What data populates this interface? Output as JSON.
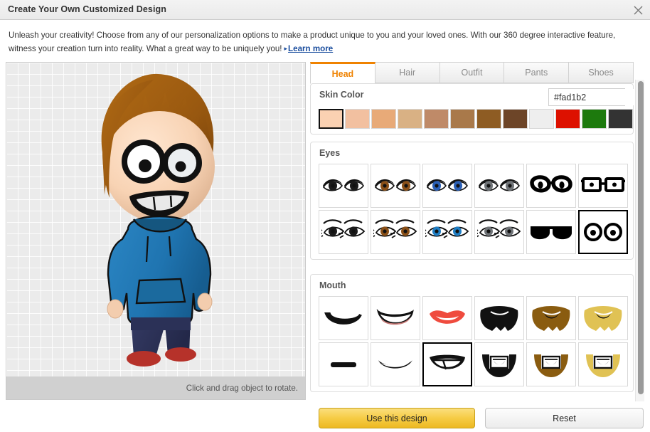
{
  "window": {
    "title": "Create Your Own Customized Design",
    "close_icon": "close-icon"
  },
  "intro": {
    "text": "Unleash your creativity! Choose from any of our personalization options to make a product unique to you and your loved ones. With our 360 degree interactive feature, witness your creation turn into reality. What a great way to be uniquely you!",
    "link_label": "Learn more",
    "link_arrow": "▸"
  },
  "preview": {
    "status_text": "Click and drag object to rotate.",
    "avatar": {
      "hair_color": "#a35f12",
      "skin_color": "#fad1b2",
      "shirt_color": "#1f74b0",
      "pants_color": "#2a2f55",
      "shoes_color": "#b6322a"
    }
  },
  "tabs": [
    {
      "label": "Head",
      "active": true
    },
    {
      "label": "Hair",
      "active": false
    },
    {
      "label": "Outfit",
      "active": false
    },
    {
      "label": "Pants",
      "active": false
    },
    {
      "label": "Shoes",
      "active": false
    }
  ],
  "skin_color": {
    "title": "Skin Color",
    "hex_value": "#fad1b2",
    "hex_placeholder": "#rrggbb",
    "preview_color": "#fad1b2",
    "swatches": [
      {
        "color": "#fad1b2",
        "selected": true
      },
      {
        "color": "#f2c0a0",
        "selected": false
      },
      {
        "color": "#e8aa78",
        "selected": false
      },
      {
        "color": "#d9b184",
        "selected": false
      },
      {
        "color": "#bf8a68",
        "selected": false
      },
      {
        "color": "#a9794a",
        "selected": false
      },
      {
        "color": "#8e5c23",
        "selected": false
      },
      {
        "color": "#6d4528",
        "selected": false
      },
      {
        "color": "#eeeeee",
        "selected": false
      },
      {
        "color": "#dd1100",
        "selected": false
      },
      {
        "color": "#1d7a0d",
        "selected": false
      },
      {
        "color": "#333333",
        "selected": false
      }
    ]
  },
  "eyes": {
    "title": "Eyes",
    "options": [
      {
        "name": "eyes-black-plain",
        "style": "plain",
        "iris": "#1a1a1a",
        "lashes": false,
        "selected": false
      },
      {
        "name": "eyes-brown-plain",
        "style": "plain",
        "iris": "#8a5018",
        "lashes": false,
        "selected": false
      },
      {
        "name": "eyes-blue-plain",
        "style": "plain",
        "iris": "#2a5fb5",
        "lashes": false,
        "selected": false
      },
      {
        "name": "eyes-grey-plain",
        "style": "plain",
        "iris": "#6f7377",
        "lashes": false,
        "selected": false
      },
      {
        "name": "eyes-round-glasses",
        "style": "glasses-round",
        "iris": "#000000",
        "lashes": false,
        "selected": false
      },
      {
        "name": "eyes-square-glasses",
        "style": "glasses-square",
        "iris": "#000000",
        "lashes": false,
        "selected": false
      },
      {
        "name": "eyes-black-lashes",
        "style": "lashes",
        "iris": "#1a1a1a",
        "lashes": true,
        "selected": false
      },
      {
        "name": "eyes-brown-lashes",
        "style": "lashes",
        "iris": "#8a5018",
        "lashes": true,
        "selected": false
      },
      {
        "name": "eyes-blue-lashes",
        "style": "lashes",
        "iris": "#1f7ec4",
        "lashes": true,
        "selected": false
      },
      {
        "name": "eyes-grey-lashes",
        "style": "lashes",
        "iris": "#6f7377",
        "lashes": true,
        "selected": false
      },
      {
        "name": "eyes-sunglasses",
        "style": "sunglasses",
        "iris": "#000000",
        "lashes": false,
        "selected": false
      },
      {
        "name": "eyes-cartoon-round",
        "style": "cartoon",
        "iris": "#000000",
        "lashes": false,
        "selected": true
      }
    ]
  },
  "mouth": {
    "title": "Mouth",
    "options": [
      {
        "name": "mouth-smile-black",
        "style": "smile-black",
        "color": "#111111",
        "selected": false
      },
      {
        "name": "mouth-open-smile-pink",
        "style": "lips-open",
        "color": "#c97b78",
        "selected": false
      },
      {
        "name": "mouth-lips-red",
        "style": "lips-red",
        "color": "#ef4b3e",
        "selected": false
      },
      {
        "name": "mouth-beard-black",
        "style": "beard",
        "color": "#111111",
        "selected": false
      },
      {
        "name": "mouth-beard-brown",
        "style": "beard",
        "color": "#8a5c10",
        "selected": false
      },
      {
        "name": "mouth-beard-blond",
        "style": "beard",
        "color": "#e0c254",
        "selected": false
      },
      {
        "name": "mouth-straight-line",
        "style": "line",
        "color": "#111111",
        "selected": false
      },
      {
        "name": "mouth-thin-smile",
        "style": "thin-smile",
        "color": "#111111",
        "selected": false
      },
      {
        "name": "mouth-grin-teeth",
        "style": "grin",
        "color": "#111111",
        "selected": true
      },
      {
        "name": "mouth-goatee-black",
        "style": "goatee",
        "color": "#111111",
        "selected": false
      },
      {
        "name": "mouth-goatee-brown",
        "style": "goatee",
        "color": "#8a5c10",
        "selected": false
      },
      {
        "name": "mouth-goatee-blond",
        "style": "goatee",
        "color": "#e0c254",
        "selected": false
      }
    ]
  },
  "footer": {
    "use_design_label": "Use this design",
    "reset_label": "Reset"
  },
  "colors": {
    "accent": "#ef8200",
    "link": "#1a4d9e",
    "primary_button": "#f6cc45"
  }
}
